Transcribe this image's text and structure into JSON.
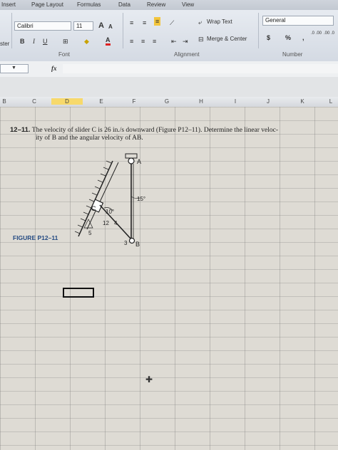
{
  "ribbon": {
    "tabs": [
      "Insert",
      "Page Layout",
      "Formulas",
      "Data",
      "Review",
      "View"
    ],
    "font_name": "Calibri",
    "font_size": "11",
    "font_group_label": "Font",
    "alignment_group_label": "Alignment",
    "number_group_label": "Number",
    "clipboard_label": "ster",
    "wrap_text": "Wrap Text",
    "merge_center": "Merge & Center",
    "number_format": "General",
    "currency_symbol": "$",
    "percent_symbol": "%",
    "bold": "B",
    "italic": "I",
    "underline": "U",
    "grow_font": "A",
    "shrink_font": "A",
    "font_color": "A",
    "inc_decimal": ".0 .00",
    "dec_decimal": ".00 .0"
  },
  "formula_bar": {
    "fx": "fx"
  },
  "columns": [
    "B",
    "C",
    "D",
    "E",
    "F",
    "G",
    "H",
    "I",
    "J",
    "K",
    "L"
  ],
  "selected_column": "D",
  "problem": {
    "number": "12–11.",
    "text_line1": "The velocity of slider C is 26 in./s downward (Figure P12–11). Determine the linear veloc-",
    "text_line2": "ity of B and the angular velocity of AB."
  },
  "figure": {
    "label": "FIGURE P12–11",
    "point_a": "A",
    "point_b": "B",
    "point_c": "C",
    "angle_top": "15°",
    "angle_mid": "10°",
    "dim_12": "12",
    "dim_4": "4",
    "slope_3": "3",
    "slope_5": "5"
  }
}
